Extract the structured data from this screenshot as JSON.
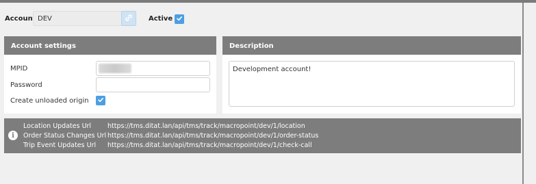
{
  "header": {
    "account_label": "Account",
    "account_value": "DEV",
    "active_label": "Active",
    "active_checked": true
  },
  "account_settings": {
    "title": "Account settings",
    "mpid_label": "MPID",
    "password_label": "Password",
    "create_unloaded_origin_label": "Create unloaded origin",
    "create_unloaded_origin_checked": true
  },
  "description": {
    "title": "Description",
    "text": "Development account!"
  },
  "info": {
    "rows": [
      {
        "label": "Location Updates Url",
        "url": "https://tms.ditat.lan/api/tms/track/macropoint/dev/1/location"
      },
      {
        "label": "Order Status Changes Url",
        "url": "https://tms.ditat.lan/api/tms/track/macropoint/dev/1/order-status"
      },
      {
        "label": "Trip Event Updates Url",
        "url": "https://tms.ditat.lan/api/tms/track/macropoint/dev/1/check-call"
      }
    ]
  },
  "colors": {
    "accent": "#4c9fe3",
    "panel_header": "#7d7d7d",
    "background": "#f0f0f0"
  },
  "icons": [
    "link-icon",
    "checkmark-icon",
    "info-icon"
  ]
}
